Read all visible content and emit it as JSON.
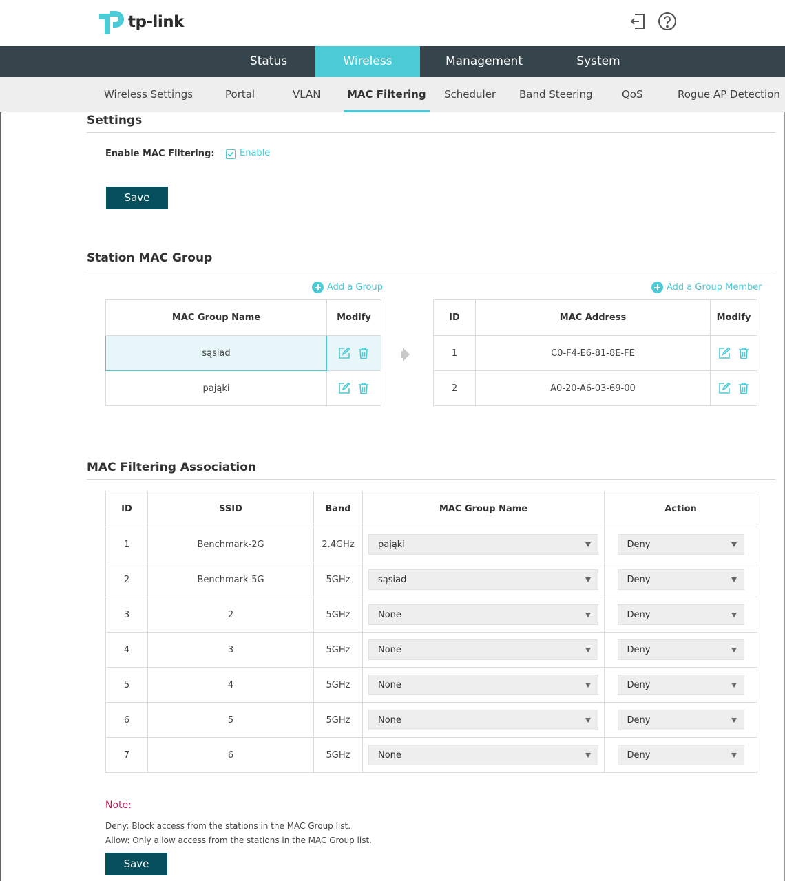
{
  "brand": {
    "name": "tp-link",
    "color": "#4acbd6"
  },
  "header_icons": [
    "logout-icon",
    "help-icon"
  ],
  "main_nav": [
    "Status",
    "Wireless",
    "Management",
    "System"
  ],
  "main_nav_active": "Wireless",
  "sub_nav": [
    "Wireless Settings",
    "Portal",
    "VLAN",
    "MAC Filtering",
    "Scheduler",
    "Band Steering",
    "QoS",
    "Rogue AP Detection"
  ],
  "sub_nav_active": "MAC Filtering",
  "settings": {
    "title": "Settings",
    "enable_label": "Enable MAC Filtering:",
    "enable_text": "Enable",
    "enabled": true,
    "save_label": "Save"
  },
  "station_group": {
    "title": "Station MAC Group",
    "add_group": "Add a Group",
    "add_member": "Add a Group Member",
    "groups_headers": [
      "MAC Group Name",
      "Modify"
    ],
    "groups": [
      "sąsiad",
      "pająki"
    ],
    "selected_group": "sąsiad",
    "members_headers": [
      "ID",
      "MAC Address",
      "Modify"
    ],
    "members": [
      {
        "id": "1",
        "mac": "C0-F4-E6-81-8E-FE"
      },
      {
        "id": "2",
        "mac": "A0-20-A6-03-69-00"
      }
    ]
  },
  "association": {
    "title": "MAC Filtering Association",
    "headers": [
      "ID",
      "SSID",
      "Band",
      "MAC Group Name",
      "Action"
    ],
    "rows": [
      {
        "id": "1",
        "ssid": "Benchmark-2G",
        "band": "2.4GHz",
        "group": "pająki",
        "action": "Deny"
      },
      {
        "id": "2",
        "ssid": "Benchmark-5G",
        "band": "5GHz",
        "group": "sąsiad",
        "action": "Deny"
      },
      {
        "id": "3",
        "ssid": "2",
        "band": "5GHz",
        "group": "None",
        "action": "Deny"
      },
      {
        "id": "4",
        "ssid": "3",
        "band": "5GHz",
        "group": "None",
        "action": "Deny"
      },
      {
        "id": "5",
        "ssid": "4",
        "band": "5GHz",
        "group": "None",
        "action": "Deny"
      },
      {
        "id": "6",
        "ssid": "5",
        "band": "5GHz",
        "group": "None",
        "action": "Deny"
      },
      {
        "id": "7",
        "ssid": "6",
        "band": "5GHz",
        "group": "None",
        "action": "Deny"
      }
    ]
  },
  "note": {
    "title": "Note:",
    "lines": [
      "Deny: Block access from the stations in the MAC Group list.",
      "Allow: Only allow access from the stations in the MAC Group list."
    ],
    "save_label": "Save"
  }
}
